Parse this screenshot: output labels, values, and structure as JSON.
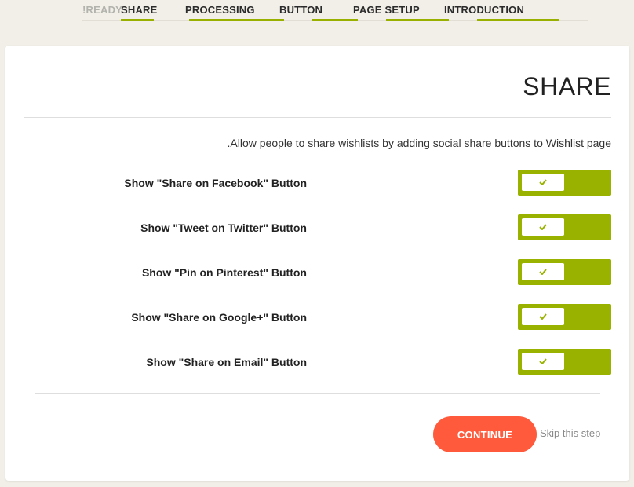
{
  "steps": [
    {
      "label": "!READY",
      "active": false
    },
    {
      "label": "SHARE",
      "active": true
    },
    {
      "label": "PROCESSING",
      "active": true
    },
    {
      "label": "BUTTON",
      "active": true
    },
    {
      "label": "PAGE SETUP",
      "active": true
    },
    {
      "label": "INTRODUCTION",
      "active": true
    }
  ],
  "card": {
    "title": "SHARE",
    "intro": ".Allow people to share wishlists by adding social share buttons to Wishlist page",
    "options": [
      {
        "label": "Show \"Share on Facebook\" Button",
        "enabled": true
      },
      {
        "label": "Show \"Tweet on Twitter\" Button",
        "enabled": true
      },
      {
        "label": "Show \"Pin on Pinterest\" Button",
        "enabled": true
      },
      {
        "label": "Show \"Share on Google+\" Button",
        "enabled": true
      },
      {
        "label": "Show \"Share on Email\" Button",
        "enabled": true
      }
    ],
    "continue_label": "CONTINUE",
    "skip_label": "Skip this step"
  },
  "colors": {
    "accent": "#99b200",
    "primary_button": "#ff5a3c",
    "background": "#f2efe8"
  },
  "icons": {
    "toggle_check": "check-icon"
  }
}
